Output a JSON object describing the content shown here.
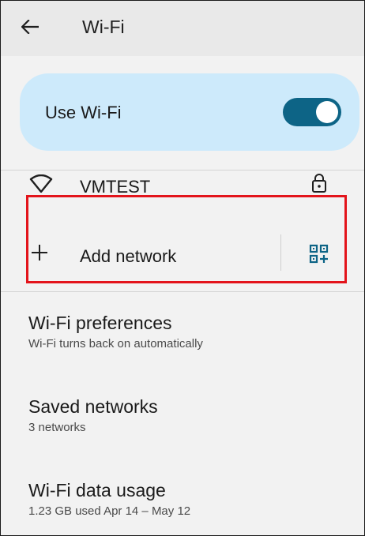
{
  "header": {
    "title": "Wi-Fi",
    "back_icon": "arrow-left-icon"
  },
  "use_wifi": {
    "label": "Use Wi-Fi",
    "toggle_on": true,
    "card_color": "#cdeafb",
    "toggle_color": "#0d6486"
  },
  "network": {
    "name": "VMTEST",
    "signal_icon": "wifi-signal-icon",
    "secured_icon": "lock-icon"
  },
  "add_network": {
    "label": "Add network",
    "plus_icon": "plus-icon",
    "qr_icon": "qr-code-scan-icon",
    "highlight_color": "#e3141b"
  },
  "preferences": [
    {
      "title": "Wi-Fi preferences",
      "subtitle": "Wi-Fi turns back on automatically"
    },
    {
      "title": "Saved networks",
      "subtitle": "3 networks"
    },
    {
      "title": "Wi-Fi data usage",
      "subtitle": "1.23 GB used Apr 14 – May 12"
    }
  ]
}
